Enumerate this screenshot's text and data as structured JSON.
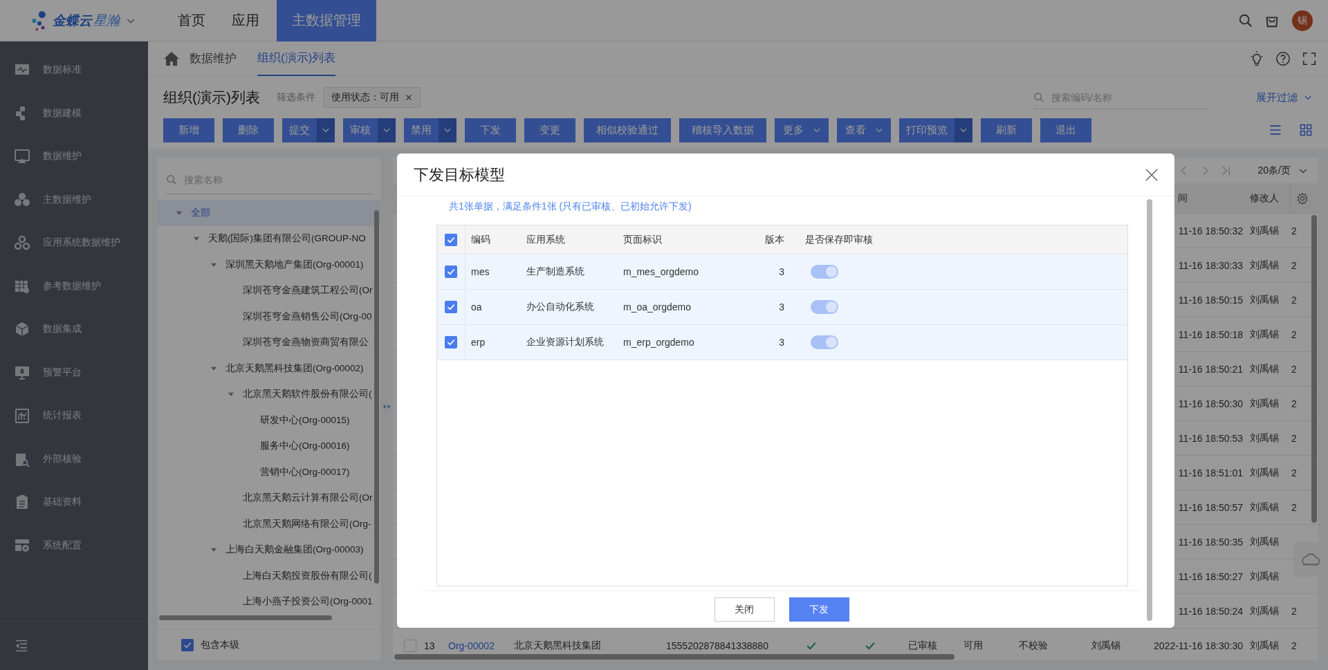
{
  "top_bar": {
    "logo": {
      "brand": "金蝶云",
      "product": "星瀚"
    },
    "nav": [
      {
        "label": "首页",
        "selected": false
      },
      {
        "label": "应用",
        "selected": false
      },
      {
        "label": "主数据管理",
        "selected": true
      }
    ],
    "avatar": "锡"
  },
  "sidebar": {
    "items": [
      {
        "label": "数据标准"
      },
      {
        "label": "数据建模"
      },
      {
        "label": "数据维护"
      },
      {
        "label": "主数据维护"
      },
      {
        "label": "应用系统数据维护"
      },
      {
        "label": "参考数据维护"
      },
      {
        "label": "数据集成"
      },
      {
        "label": "预警平台"
      },
      {
        "label": "统计报表"
      },
      {
        "label": "外部核验"
      },
      {
        "label": "基础资料"
      },
      {
        "label": "系统配置"
      }
    ]
  },
  "breadcrumb": [
    {
      "label": "数据维护",
      "selected": false
    },
    {
      "label": "组织(演示)列表",
      "selected": true
    }
  ],
  "page": {
    "title": "组织(演示)列表",
    "filter_label": "筛选条件",
    "filter_tags": [
      "使用状态：可用"
    ],
    "search": {
      "placeholder": "搜索编码/名称"
    },
    "expand_filter": "展开过滤"
  },
  "toolbar": [
    {
      "label": "新增",
      "kind": "plain"
    },
    {
      "label": "删除",
      "kind": "plain"
    },
    {
      "label": "提交",
      "kind": "split"
    },
    {
      "label": "审核",
      "kind": "split"
    },
    {
      "label": "禁用",
      "kind": "split"
    },
    {
      "label": "下发",
      "kind": "plain"
    },
    {
      "label": "变更",
      "kind": "plain"
    },
    {
      "label": "相似校验通过",
      "kind": "plain"
    },
    {
      "label": "稽核导入数据",
      "kind": "plain"
    },
    {
      "label": "更多",
      "kind": "menu"
    },
    {
      "label": "查看",
      "kind": "menu"
    },
    {
      "label": "打印预览",
      "kind": "split"
    },
    {
      "label": "刷新",
      "kind": "plain"
    },
    {
      "label": "退出",
      "kind": "plain"
    }
  ],
  "tree": {
    "search": {
      "placeholder": "搜索名称"
    },
    "items": [
      {
        "label": "全部",
        "selected": true,
        "expanded": true,
        "children": [
          {
            "label": "天鹅(国际)集团有限公司(GROUP-NO",
            "selected": false,
            "expanded": true,
            "children": [
              {
                "label": "深圳黑天鹅地产集团(Org-00001)",
                "selected": false,
                "expanded": true,
                "children": [
                  {
                    "label": "深圳苍穹金燕建筑工程公司(Or",
                    "selected": false
                  },
                  {
                    "label": "深圳苍穹金燕销售公司(Org-00",
                    "selected": false
                  },
                  {
                    "label": "深圳苍穹金燕物资商贸有限公",
                    "selected": false
                  }
                ]
              },
              {
                "label": "北京天鹅黑科技集团(Org-00002)",
                "selected": false,
                "expanded": true,
                "children": [
                  {
                    "label": "北京黑天鹅软件股份有限公司(",
                    "selected": false,
                    "expanded": true,
                    "children": [
                      {
                        "label": "研发中心(Org-00015)",
                        "selected": false
                      },
                      {
                        "label": "服务中心(Org-00016)",
                        "selected": false
                      },
                      {
                        "label": "营销中心(Org-00017)",
                        "selected": false
                      }
                    ]
                  },
                  {
                    "label": "北京黑天鹅云计算有限公司(Or",
                    "selected": false
                  },
                  {
                    "label": "北京黑天鹅网络有限公司(Org-",
                    "selected": false
                  }
                ]
              },
              {
                "label": "上海白天鹅金融集团(Org-00003)",
                "selected": false,
                "expanded": true,
                "children": [
                  {
                    "label": "上海白天鹅投资股份有限公司(",
                    "selected": false
                  },
                  {
                    "label": "上海小燕子投资公司(Org-0001",
                    "selected": false
                  }
                ]
              }
            ]
          }
        ]
      }
    ],
    "include_self": {
      "label": "包含本级",
      "checked": true
    }
  },
  "table": {
    "pagination": {
      "page_size": "20条/页"
    },
    "header": {
      "column_12": "间",
      "column_13": "修改人"
    },
    "rows": [
      {
        "column_12": "11-16 18:50:32",
        "column_13": "刘禹锡",
        "column_14": "2"
      },
      {
        "column_12": "11-16 18:30:33",
        "column_13": "刘禹锡",
        "column_14": "2"
      },
      {
        "column_12": "11-16 18:50:15",
        "column_13": "刘禹锡",
        "column_14": "2"
      },
      {
        "column_12": "11-16 18:50:18",
        "column_13": "刘禹锡",
        "column_14": "2"
      },
      {
        "column_12": "11-16 18:50:21",
        "column_13": "刘禹锡",
        "column_14": "2"
      },
      {
        "column_12": "11-16 18:50:30",
        "column_13": "刘禹锡",
        "column_14": "2"
      },
      {
        "column_12": "11-16 18:50:53",
        "column_13": "刘禹锡",
        "column_14": "2"
      },
      {
        "column_12": "11-16 18:51:01",
        "column_13": "刘禹锡",
        "column_14": "2"
      },
      {
        "column_12": "11-16 18:50:57",
        "column_13": "刘禹锡",
        "column_14": "2"
      },
      {
        "column_12": "11-16 18:50:35",
        "column_13": "刘禹锡"
      },
      {
        "column_12": "11-16 18:50:27",
        "column_13": "刘禹锡"
      },
      {
        "column_12": "11-16 18:50:24",
        "column_13": "刘禹锡",
        "column_14": "2"
      },
      {
        "selected": false,
        "column_2": "13",
        "column_3": "Org-00002",
        "column_4": "北京天鹅黑科技集团",
        "column_5": "1555202878841338880",
        "column_6": true,
        "column_7": true,
        "column_8": "已审核",
        "column_9": "可用",
        "column_10": "不校验",
        "column_11": "刘禹锡",
        "column_12": "2022-11-16 18:30:30",
        "column_13": "刘禹锡",
        "column_14": "2"
      }
    ]
  },
  "dialog": {
    "title": "下发目标模型",
    "info": "共1张单据，满足条件1张 (只有已审核、已初始允许下发)",
    "table": {
      "all_checked": true,
      "columns": [
        "编码",
        "应用系统",
        "页面标识",
        "版本",
        "是否保存即审核"
      ],
      "rows": [
        {
          "checked": true,
          "code": "mes",
          "system": "生产制造系统",
          "page_id": "m_mes_orgdemo",
          "version": "3",
          "auto_audit": true
        },
        {
          "checked": true,
          "code": "oa",
          "system": "办公自动化系统",
          "page_id": "m_oa_orgdemo",
          "version": "3",
          "auto_audit": true
        },
        {
          "checked": true,
          "code": "erp",
          "system": "企业资源计划系统",
          "page_id": "m_erp_orgdemo",
          "version": "3",
          "auto_audit": true
        }
      ]
    },
    "buttons": [
      {
        "label": "关闭",
        "kind": "secondary"
      },
      {
        "label": "下发",
        "kind": "primary"
      }
    ]
  }
}
